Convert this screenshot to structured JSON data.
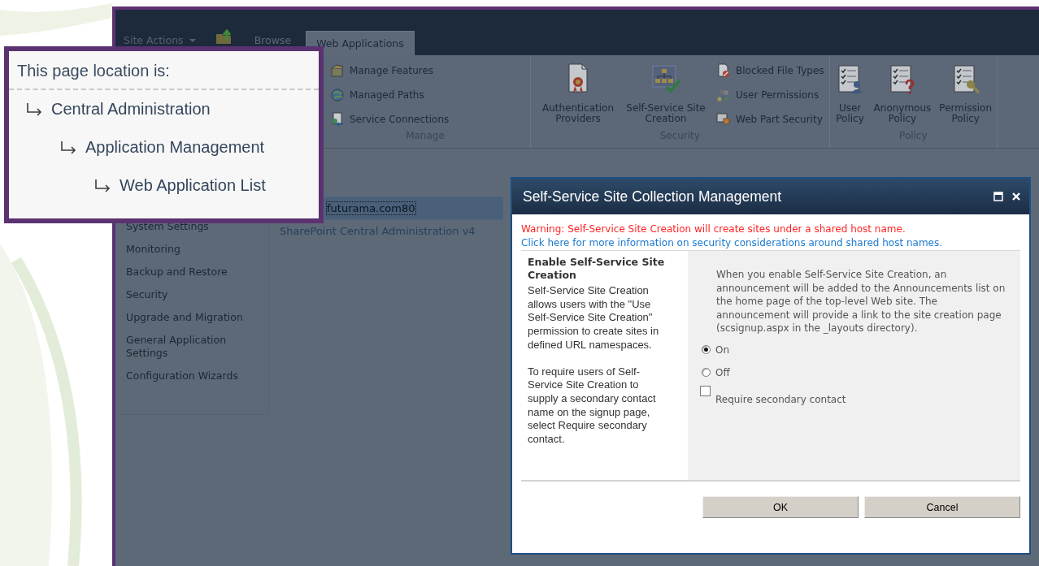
{
  "ribbon": {
    "tabs": [
      {
        "label": "Site Actions",
        "kind": "menu",
        "selected": false
      },
      {
        "label": "Browse",
        "kind": "tab",
        "selected": false
      },
      {
        "label": "Web Applications",
        "kind": "tab",
        "selected": true
      }
    ],
    "groups": [
      {
        "label": "Manage",
        "items": [
          {
            "label": "Manage Features",
            "kind": "small"
          },
          {
            "label": "Managed Paths",
            "kind": "small"
          },
          {
            "label": "Service Connections",
            "kind": "small"
          }
        ]
      },
      {
        "label": "Security",
        "items": [
          {
            "label": "Authentication Providers",
            "kind": "large"
          },
          {
            "label": "Self-Service Site Creation",
            "kind": "large"
          },
          {
            "label": "Blocked File Types",
            "kind": "small"
          },
          {
            "label": "User Permissions",
            "kind": "small"
          },
          {
            "label": "Web Part Security",
            "kind": "small"
          }
        ]
      },
      {
        "label": "Policy",
        "items": [
          {
            "label": "User Policy",
            "kind": "large"
          },
          {
            "label": "Anonymous Policy",
            "kind": "large"
          },
          {
            "label": "Permission Policy",
            "kind": "large"
          }
        ]
      }
    ]
  },
  "sidebar": {
    "items": [
      "System Settings",
      "Monitoring",
      "Backup and Restore",
      "Security",
      "Upgrade and Migration",
      "General Application Settings",
      "Configuration Wizards"
    ]
  },
  "list": {
    "rows": [
      {
        "text": "futurama.com80",
        "selected": true
      },
      {
        "text": "SharePoint Central Administration v4",
        "selected": false
      }
    ]
  },
  "callout": {
    "title": "This page location is:",
    "items": [
      {
        "label": "Central Administration",
        "children": [
          {
            "label": "Application Management",
            "children": [
              {
                "label": "Web Application List"
              }
            ]
          }
        ]
      }
    ]
  },
  "dialog": {
    "title": "Self-Service Site Collection Management",
    "warning": "Warning: Self-Service Site Creation will create sites under a shared host name.",
    "link": "Click here for more information on security considerations around shared host names.",
    "section_title": "Enable Self-Service Site Creation",
    "section_description": [
      "Self-Service Site Creation allows users with the \"Use Self-Service Site Creation\" permission to create sites in defined URL namespaces.",
      "To require users of Self-Service Site Creation to supply a secondary contact name on the signup page, select Require secondary contact."
    ],
    "option_description": "When you enable Self-Service Site Creation, an announcement will be added to the Announcements list on the home page of the top-level Web site. The announcement will provide a link to the site creation page  (scsignup.aspx in the _layouts directory).",
    "options": [
      {
        "label": "On",
        "selected": true
      },
      {
        "label": "Off",
        "selected": false
      }
    ],
    "checkbox": {
      "label": "Require secondary contact",
      "checked": false
    },
    "buttons": [
      "OK",
      "Cancel"
    ]
  }
}
